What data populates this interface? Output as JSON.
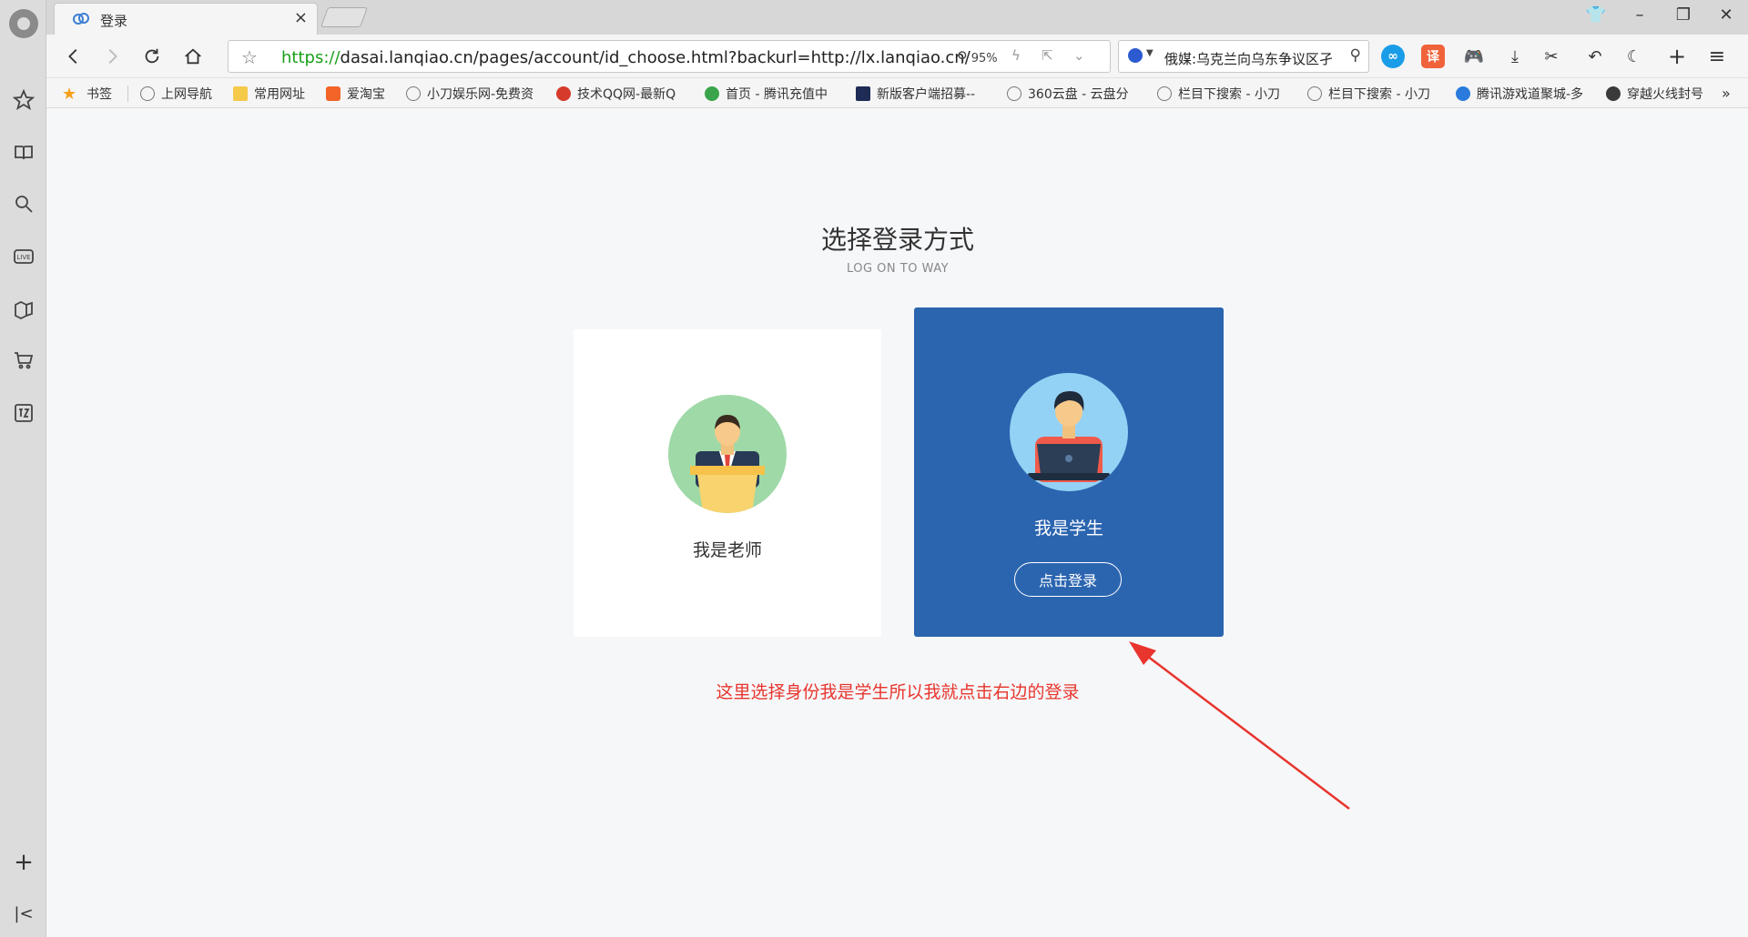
{
  "tab": {
    "title": "登录",
    "close": "×"
  },
  "window": {
    "minimize": "–",
    "maximize": "❐",
    "close": "✕",
    "skin": "👕"
  },
  "address": {
    "protocol": "https://",
    "rest": "dasai.lanqiao.cn/pages/account/id_choose.html?backurl=http://lx.lanqiao.cn/",
    "zoom": "95%"
  },
  "search": {
    "query": "俄媒:乌克兰向乌东争议区孑"
  },
  "toolbar": {
    "translate": "译",
    "new_tab": "+",
    "menu": "≡"
  },
  "bookmarks": [
    {
      "label": "书签"
    },
    {
      "label": "上网导航"
    },
    {
      "label": "常用网址"
    },
    {
      "label": "爱淘宝"
    },
    {
      "label": "小刀娱乐网-免费资"
    },
    {
      "label": "技术QQ网-最新Q"
    },
    {
      "label": "首页 - 腾讯充值中"
    },
    {
      "label": "新版客户端招募--"
    },
    {
      "label": "360云盘 - 云盘分"
    },
    {
      "label": "栏目下搜索 - 小刀"
    },
    {
      "label": "栏目下搜索 - 小刀"
    },
    {
      "label": "腾讯游戏道聚城-多"
    },
    {
      "label": "穿越火线封号"
    }
  ],
  "bookmarks_more": "»",
  "sidebar": {
    "add": "+",
    "collapse": "|<"
  },
  "page": {
    "title": "选择登录方式",
    "subtitle": "LOG ON TO WAY",
    "teacher_label": "我是老师",
    "student_label": "我是学生",
    "login_button": "点击登录",
    "annotation": "这里选择身份我是学生所以我就点击右边的登录"
  },
  "colors": {
    "student_card": "#2b65b0",
    "annotation": "#e8352d",
    "url_protocol": "#1aa01a"
  }
}
